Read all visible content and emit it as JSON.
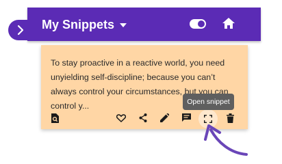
{
  "header": {
    "title": "My Snippets",
    "theme_toggle_on": true
  },
  "snippet": {
    "text": "To stay proactive in a reactive world, you need unyielding self-discipline; because you can’t always control your circumstances, but you can control y..."
  },
  "tooltip": {
    "label": "Open snippet"
  },
  "icons": {
    "expand": "chevron-right-icon",
    "title_menu": "caret-down-icon",
    "theme": "toggle-icon",
    "home": "home-icon",
    "snippet_info": "document-search-icon",
    "favorite": "heart-outline-icon",
    "share": "share-icon",
    "edit": "pencil-icon",
    "comment": "comment-icon",
    "open": "fullscreen-icon",
    "delete": "trash-icon",
    "annotation": "curved-arrow-icon"
  },
  "colors": {
    "header_bg": "#5b2bb5",
    "card_bg": "#ffd6a5",
    "tooltip_bg": "#5f5f5f",
    "arrow": "#6a46b8"
  }
}
